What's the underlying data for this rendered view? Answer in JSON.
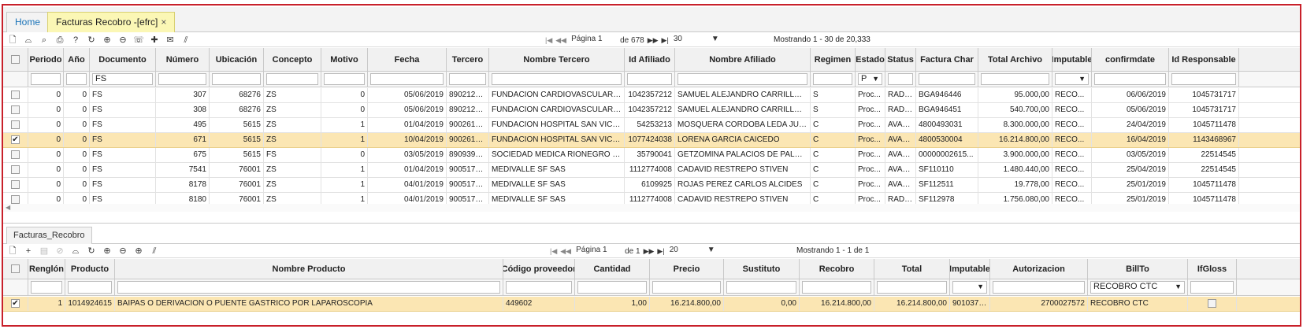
{
  "tabs": {
    "home": "Home",
    "main": "Facturas Recobro -[efrc]",
    "close": "×"
  },
  "top_toolbar": {
    "icons": [
      "new-icon",
      "filter-icon",
      "search-icon",
      "print-icon",
      "help-icon",
      "refresh-icon",
      "zoom-in-icon",
      "zoom-out-icon",
      "comment-icon",
      "pin-icon",
      "mail-icon",
      "resize-icon"
    ]
  },
  "top_pager": {
    "first": "|◀",
    "prev": "◀◀",
    "page_label": "Página 1",
    "of_label": "de 678",
    "next": "▶▶",
    "last": "▶|",
    "page_size": "30",
    "dropdown": "▼",
    "showing": "Mostrando 1 - 30 de 20,333"
  },
  "top_grid": {
    "columns": [
      "Periodo",
      "Año",
      "Documento",
      "Número",
      "Ubicación",
      "Concepto",
      "Motivo",
      "Fecha",
      "Tercero",
      "Nombre Tercero",
      "Id Afiliado",
      "Nombre Afiliado",
      "Regimen",
      "Estado",
      "Status",
      "Factura Char",
      "Total Archivo",
      "Imputable",
      "confirmdate",
      "Id Responsable"
    ],
    "filters": [
      "",
      "",
      "FS",
      "",
      "",
      "",
      "",
      "",
      "",
      "",
      "",
      "",
      "",
      "P",
      "",
      "",
      "",
      "",
      "",
      ""
    ],
    "rows": [
      {
        "checked": false,
        "cells": [
          "0",
          "0",
          "FS",
          "307",
          "68276",
          "ZS",
          "0",
          "05/06/2019",
          "8902125...",
          "FUNDACION CARDIOVASCULAR ...",
          "1042357212",
          "SAMUEL ALEJANDRO CARRILLO ...",
          "S",
          "Proc...",
          "RADI...",
          "BGA946446",
          "95.000,00",
          "RECO...",
          "06/06/2019",
          "1045731717"
        ]
      },
      {
        "checked": false,
        "cells": [
          "0",
          "0",
          "FS",
          "308",
          "68276",
          "ZS",
          "0",
          "05/06/2019",
          "8902125...",
          "FUNDACION CARDIOVASCULAR ...",
          "1042357212",
          "SAMUEL ALEJANDRO CARRILLO ...",
          "S",
          "Proc...",
          "RADI...",
          "BGA946451",
          "540.700,00",
          "RECO...",
          "05/06/2019",
          "1045731717"
        ]
      },
      {
        "checked": false,
        "cells": [
          "0",
          "0",
          "FS",
          "495",
          "5615",
          "ZS",
          "1",
          "01/04/2019",
          "9002613...",
          "FUNDACION HOSPITAL SAN VICE...",
          "54253213",
          "MOSQUERA CORDOBA LEDA JUL...",
          "C",
          "Proc...",
          "AVAL...",
          "4800493031",
          "8.300.000,00",
          "RECO...",
          "24/04/2019",
          "1045711478"
        ]
      },
      {
        "checked": true,
        "cells": [
          "0",
          "0",
          "FS",
          "671",
          "5615",
          "ZS",
          "1",
          "10/04/2019",
          "9002613...",
          "FUNDACION HOSPITAL SAN VICE...",
          "1077424038",
          "LORENA GARCIA CAICEDO",
          "C",
          "Proc...",
          "AVAL...",
          "4800530004",
          "16.214.800,00",
          "RECO...",
          "16/04/2019",
          "1143468967"
        ]
      },
      {
        "checked": false,
        "cells": [
          "0",
          "0",
          "FS",
          "675",
          "5615",
          "FS",
          "0",
          "03/05/2019",
          "8909399...",
          "SOCIEDAD MEDICA RIONEGRO S...",
          "35790041",
          "GETZOMINA PALACIOS DE PALAC...",
          "C",
          "Proc...",
          "AVAL...",
          "00000002615...",
          "3.900.000,00",
          "RECO...",
          "03/05/2019",
          "22514545"
        ]
      },
      {
        "checked": false,
        "cells": [
          "0",
          "0",
          "FS",
          "7541",
          "76001",
          "ZS",
          "1",
          "01/04/2019",
          "9005179...",
          "MEDIVALLE SF SAS",
          "1112774008",
          "CADAVID RESTREPO STIVEN",
          "C",
          "Proc...",
          "AVAL...",
          "SF110110",
          "1.480.440,00",
          "RECO...",
          "25/04/2019",
          "22514545"
        ]
      },
      {
        "checked": false,
        "cells": [
          "0",
          "0",
          "FS",
          "8178",
          "76001",
          "ZS",
          "1",
          "04/01/2019",
          "9005179...",
          "MEDIVALLE SF SAS",
          "6109925",
          "ROJAS PEREZ CARLOS ALCIDES",
          "C",
          "Proc...",
          "AVAL...",
          "SF112511",
          "19.778,00",
          "RECO...",
          "25/01/2019",
          "1045711478"
        ]
      },
      {
        "checked": false,
        "cells": [
          "0",
          "0",
          "FS",
          "8180",
          "76001",
          "ZS",
          "1",
          "04/01/2019",
          "9005179...",
          "MEDIVALLE SF SAS",
          "1112774008",
          "CADAVID RESTREPO STIVEN",
          "C",
          "Proc...",
          "RADI...",
          "SF112978",
          "1.756.080,00",
          "RECO...",
          "25/01/2019",
          "1045711478"
        ]
      }
    ]
  },
  "sub_tab": "Facturas_Recobro",
  "bottom_toolbar": {
    "icons": [
      "new-icon",
      "add-icon",
      "save-icon",
      "cancel-icon",
      "filter-icon",
      "refresh-icon",
      "zoom-in-icon",
      "zoom-out-icon",
      "plus-circle-icon",
      "resize-icon"
    ]
  },
  "bottom_pager": {
    "first": "|◀",
    "prev": "◀◀",
    "page_label": "Página 1",
    "of_label": "de 1",
    "next": "▶▶",
    "last": "▶|",
    "page_size": "20",
    "dropdown": "▼",
    "showing": "Mostrando 1 - 1 de 1"
  },
  "bottom_grid": {
    "columns": [
      "Renglón",
      "Producto",
      "Nombre Producto",
      "Código proveedor",
      "Cantidad",
      "Precio",
      "Sustituto",
      "Recobro",
      "Total",
      "Imputable",
      "Autorizacion",
      "BillTo",
      "IfGloss"
    ],
    "filters": [
      "",
      "",
      "",
      "",
      "",
      "",
      "",
      "",
      "",
      "",
      "",
      "RECOBRO CTC",
      ""
    ],
    "rows": [
      {
        "checked": true,
        "cells": [
          "1",
          "1014924615",
          "BAIPAS O DERIVACION O PUENTE GASTRICO POR LAPAROSCOPIA",
          "449602",
          "1,00",
          "16.214.800,00",
          "0,00",
          "16.214.800,00",
          "16.214.800,00",
          "9010379...",
          "2700027572",
          "RECOBRO CTC",
          ""
        ]
      }
    ]
  }
}
